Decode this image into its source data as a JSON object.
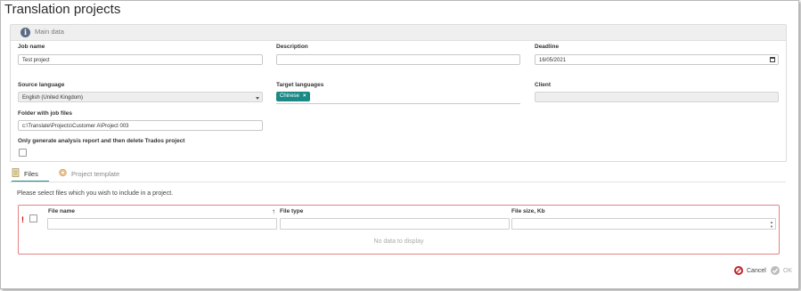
{
  "page": {
    "title": "Translation projects"
  },
  "main_data": {
    "header": "Main data",
    "job_name": {
      "label": "Job name",
      "value": "Test project"
    },
    "description": {
      "label": "Description",
      "value": ""
    },
    "deadline": {
      "label": "Deadline",
      "value": "16/05/2021"
    },
    "source_language": {
      "label": "Source language",
      "value": "English (United Kingdom)"
    },
    "target_languages": {
      "label": "Target languages",
      "chips": [
        "Chinese"
      ]
    },
    "client": {
      "label": "Client",
      "value": ""
    },
    "folder": {
      "label": "Folder with job files",
      "value": "c:\\Translate\\Projects\\Customer A\\Project 003"
    },
    "analysis_only": {
      "label": "Only generate analysis report and then delete Trados project",
      "checked": false
    }
  },
  "tabs": [
    {
      "label": "Files",
      "active": true
    },
    {
      "label": "Project template",
      "active": false
    }
  ],
  "files": {
    "hint": "Please select files which you wish to include in a project.",
    "columns": [
      "File name",
      "File type",
      "File size, Kb"
    ],
    "empty_text": "No data to display",
    "error_marker": "!"
  },
  "footer": {
    "cancel_label": "Cancel",
    "ok_label": "OK"
  },
  "colors": {
    "accent": "#1b8a86",
    "error_border": "#e28383",
    "cancel_icon": "#c0272d",
    "ok_icon_disabled": "#bdbdbd"
  }
}
